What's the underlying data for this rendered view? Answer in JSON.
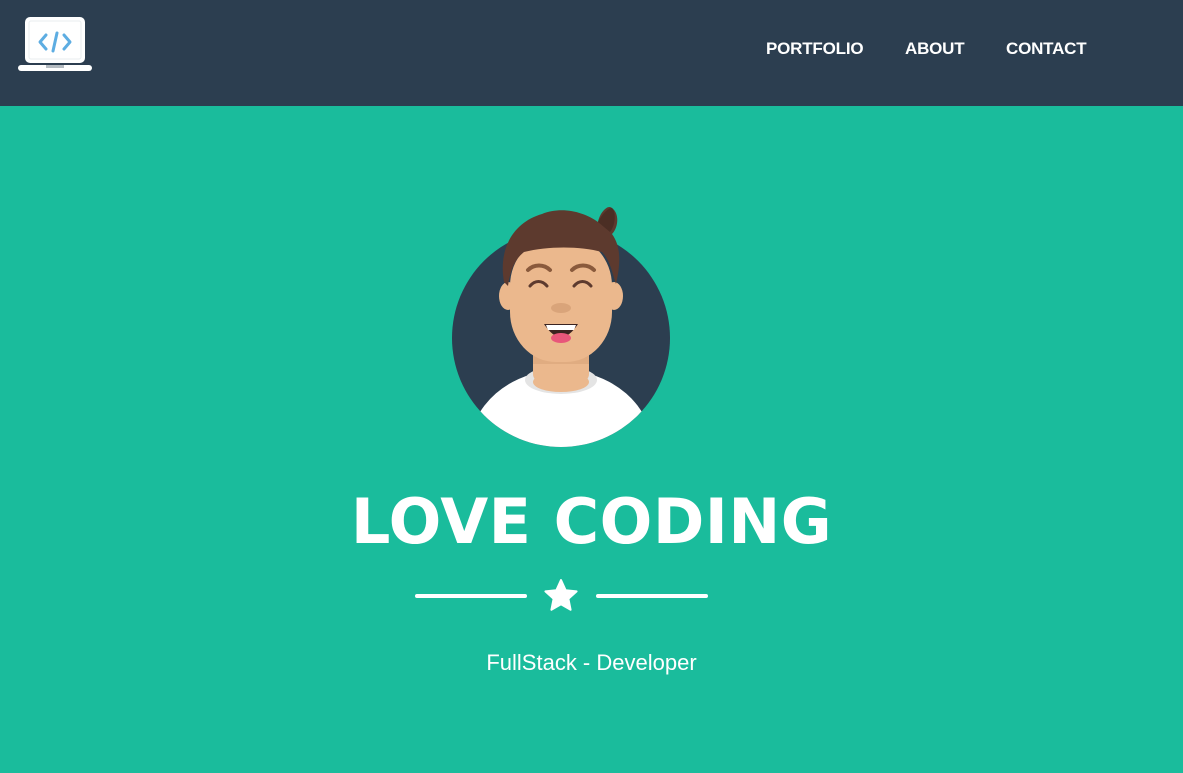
{
  "navbar": {
    "logo_icon": "laptop-code-icon",
    "links": [
      {
        "label": "PORTFOLIO"
      },
      {
        "label": "ABOUT"
      },
      {
        "label": "CONTACT"
      }
    ]
  },
  "hero": {
    "avatar_icon": "smiling-developer-avatar",
    "title": "LOVE CODING",
    "divider_icon": "star-icon",
    "subtitle": "FullStack - Developer"
  },
  "colors": {
    "navbar_bg": "#2c3e50",
    "hero_bg": "#1abc9c",
    "text": "#ffffff",
    "logo_code": "#5dade2"
  }
}
